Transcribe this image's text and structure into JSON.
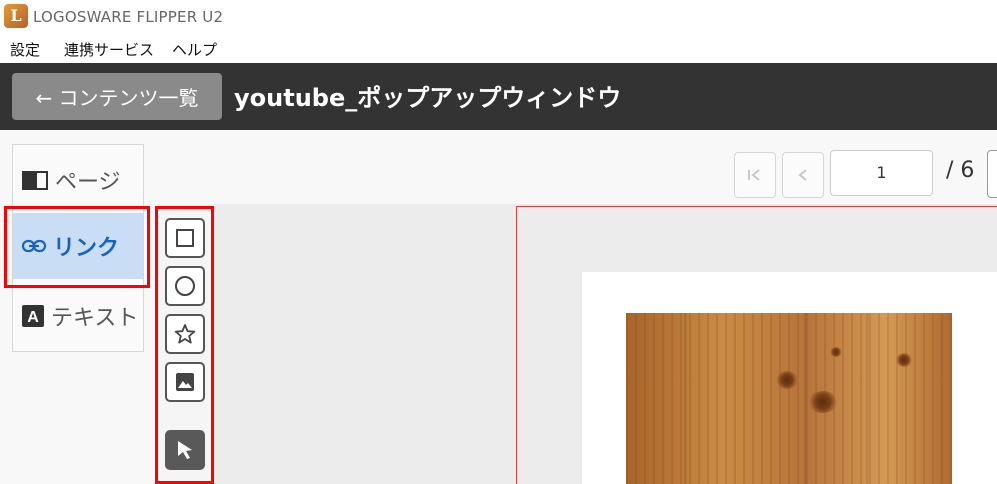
{
  "app": {
    "title": "LOGOSWARE FLIPPER U2",
    "logo_letter": "L"
  },
  "menu": {
    "items": [
      "設定",
      "連携サービス",
      "ヘルプ"
    ]
  },
  "header": {
    "back_label": "← コンテンツ一覧",
    "document_title": "youtube_ポップアップウィンドウ"
  },
  "side_tabs": [
    {
      "label": "ページ",
      "icon": "book-icon",
      "active": false
    },
    {
      "label": "リンク",
      "icon": "link-icon",
      "active": true
    },
    {
      "label": "テキスト",
      "icon": "text-a-icon",
      "active": false
    }
  ],
  "pager": {
    "current_page": "1",
    "total": "/ 6"
  },
  "tools": [
    "rectangle-tool",
    "circle-tool",
    "star-tool",
    "image-tool",
    "select-arrow-tool"
  ],
  "colors": {
    "header_bg": "#333333",
    "active_tab_bg": "#c9def5",
    "active_tab_text": "#1565c0",
    "highlight": "#ff0000"
  }
}
